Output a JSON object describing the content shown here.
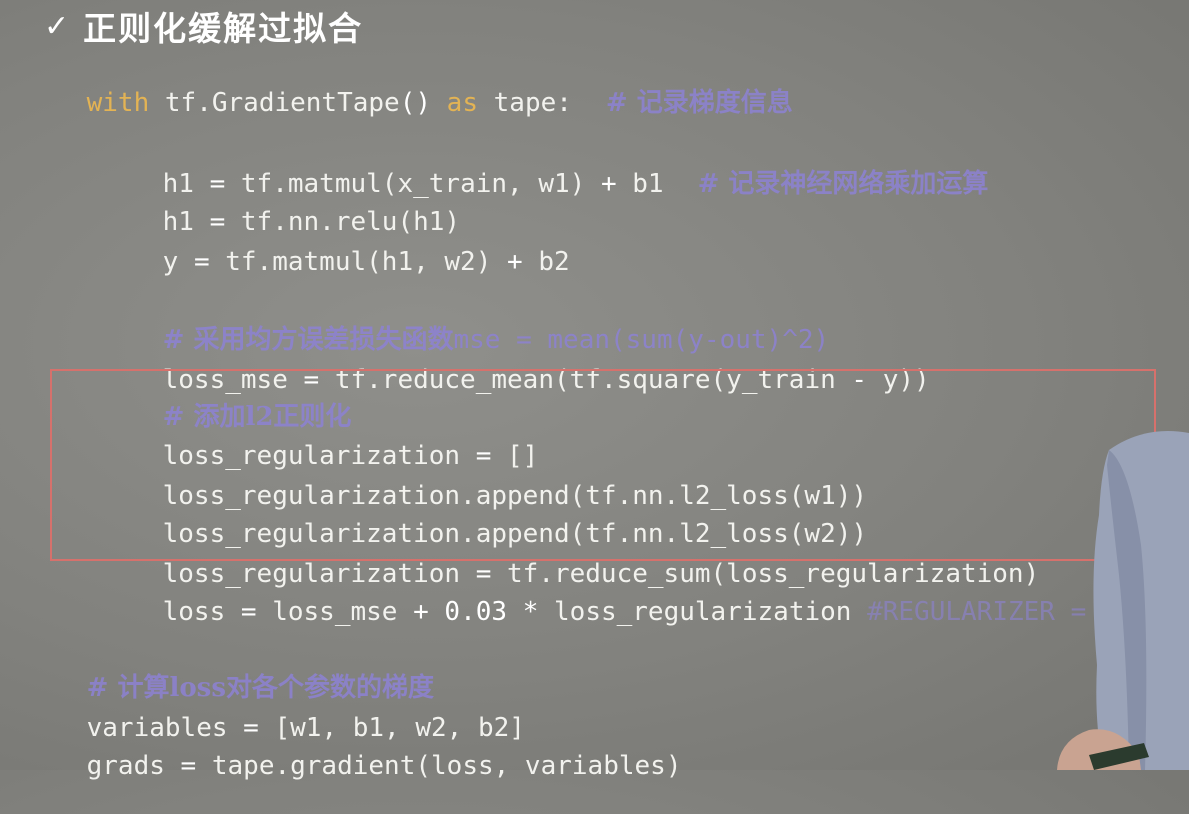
{
  "slide": {
    "check_glyph": "✓",
    "title": "正则化缓解过拟合"
  },
  "code": {
    "l1": {
      "kw1": "with",
      "t1": " tf.GradientTape",
      "p1": "()",
      "kw2": " as",
      "t2": " tape:",
      "c": "# 记录梯度信息"
    },
    "l2": {
      "t1": "h1 ",
      "op1": "=",
      "t2": " tf.matmul",
      "t3": "(x_train, w1)",
      "op2": " +",
      "t4": " b1",
      "c": "# 记录神经网络乘加运算"
    },
    "l3": {
      "t1": "h1 ",
      "op1": "=",
      "t2": " tf.nn.relu",
      "t3": "(h1)"
    },
    "l4": {
      "t1": "y ",
      "op1": "=",
      "t2": " tf.matmul",
      "t3": "(h1, w2)",
      "op2": " +",
      "t4": " b2"
    },
    "l5": {
      "c1": "# 采用均方误差损失函数",
      "c2": "mse = mean(sum(y-out)^2)"
    },
    "l6": {
      "t1": "loss_mse ",
      "op1": "=",
      "t2": " tf.reduce_mean",
      "t3": "(tf.square",
      "t4": "(y_train",
      "op2": " -",
      "t5": " y))"
    },
    "l7": {
      "c": "# 添加l2正则化"
    },
    "l8": {
      "t1": "loss_regularization ",
      "op1": "=",
      "t2": " []"
    },
    "l9": {
      "t1": "loss_regularization.append",
      "t2": "(tf.nn.l2_loss",
      "t3": "(w1))"
    },
    "l10": {
      "t1": "loss_regularization.append",
      "t2": "(tf.nn.l2_loss",
      "t3": "(w2))"
    },
    "l11": {
      "t1": "loss_regularization ",
      "op1": "=",
      "t2": " tf.reduce_sum",
      "t3": "(loss_regularization)"
    },
    "l12": {
      "t1": "loss ",
      "op1": "=",
      "t2": " loss_mse ",
      "op2": "+",
      "n": " 0.03",
      "op3": " *",
      "t3": " loss_regularization ",
      "c": "#REGULARIZER ="
    },
    "l13": {
      "c": "# 计算loss对各个参数的梯度"
    },
    "l14": {
      "t1": "variables ",
      "op1": "=",
      "t2": " [w1, b1, w2, b2]"
    },
    "l15": {
      "t1": "grads ",
      "op1": "=",
      "t2": " tape.gradient",
      "t3": "(loss, variables)"
    }
  },
  "colors": {
    "keyword": "#e3b354",
    "comment": "#8d82d4",
    "code": "#f2f2ee",
    "box": "#d6716c"
  }
}
